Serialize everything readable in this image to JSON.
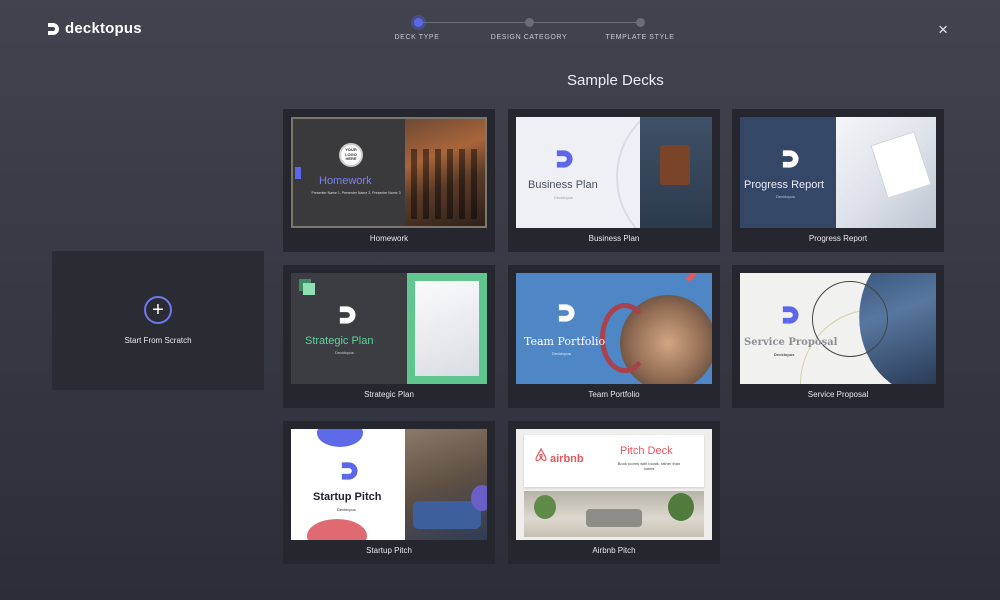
{
  "brand": {
    "name": "decktopus",
    "accent": "#5b67e8"
  },
  "stepper": {
    "steps": [
      {
        "label": "DECK TYPE",
        "active": true
      },
      {
        "label": "DESIGN CATEGORY",
        "active": false
      },
      {
        "label": "TEMPLATE STYLE",
        "active": false
      }
    ]
  },
  "close": {
    "icon": "close-icon",
    "glyph": "×"
  },
  "section_title": "Sample Decks",
  "scratch": {
    "label": "Start From Scratch",
    "icon": "plus-icon",
    "glyph": "+"
  },
  "decks": [
    {
      "id": "homework",
      "caption": "Homework",
      "title": "Homework",
      "badge": "YOUR LOGO HERE",
      "subtitle": "Presenter Name 1, Presenter Name 2, Presenter Name 3"
    },
    {
      "id": "business",
      "caption": "Business Plan",
      "title": "Business Plan",
      "subtitle": "Decktopus"
    },
    {
      "id": "progress",
      "caption": "Progress Report",
      "title": "Progress Report",
      "subtitle": "Decktopus"
    },
    {
      "id": "strategic",
      "caption": "Strategic Plan",
      "title": "Strategic Plan",
      "subtitle": "Decktopus"
    },
    {
      "id": "team",
      "caption": "Team Portfolio",
      "title": "Team Portfolio",
      "subtitle": "Decktopus"
    },
    {
      "id": "service",
      "caption": "Service Proposal",
      "title": "Service Proposal",
      "subtitle": "Decktopus"
    },
    {
      "id": "startup",
      "caption": "Startup Pitch",
      "title": "Startup Pitch",
      "subtitle": "Decktopus"
    },
    {
      "id": "airbnb",
      "caption": "Airbnb Pitch",
      "brand": "airbnb",
      "title": "Pitch Deck",
      "subtitle": "Book rooms with locals, rather than hotels"
    }
  ]
}
